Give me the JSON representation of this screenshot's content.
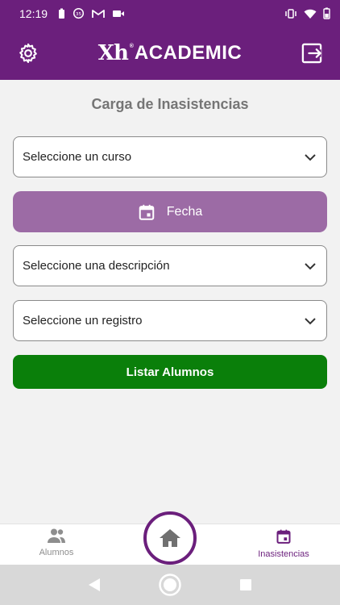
{
  "status_bar": {
    "time": "12:19"
  },
  "app_bar": {
    "logo_mark": "Xh",
    "logo_reg": "®",
    "logo_text": "ACADEMIC"
  },
  "page": {
    "title": "Carga de Inasistencias",
    "course_select": "Seleccione un curso",
    "date_button": "Fecha",
    "description_select": "Seleccione una descripción",
    "record_select": "Seleccione un registro",
    "list_button": "Listar Alumnos"
  },
  "bottom_nav": {
    "items": [
      {
        "label": "Alumnos",
        "icon": "people-icon"
      },
      {
        "label": "Inasistencias",
        "icon": "calendar-icon",
        "active": true
      }
    ],
    "center": {
      "icon": "home-icon"
    }
  },
  "colors": {
    "primary": "#6b1f7c",
    "date_button": "#9c6ba5",
    "list_button": "#0a7f0a",
    "background": "#f2f2f2"
  }
}
